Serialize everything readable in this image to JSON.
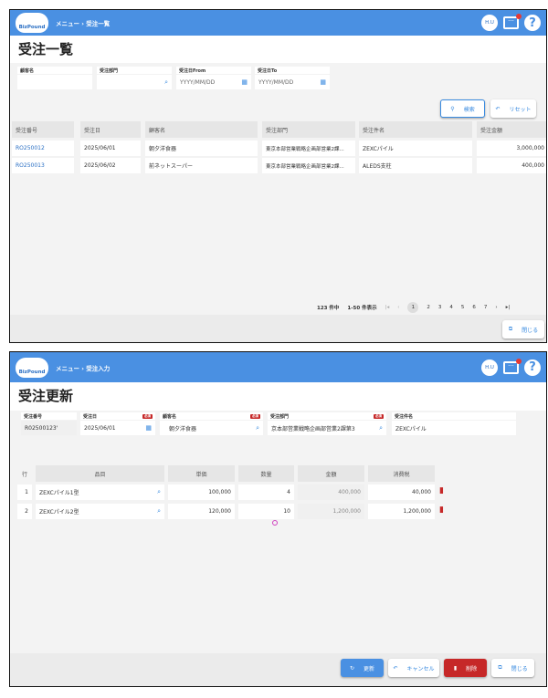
{
  "list_screen": {
    "header": {
      "logo": "BizPound",
      "breadcrumb": "メニュー › 受注一覧",
      "user": "H.U",
      "help": "?"
    },
    "title": "受注一覧",
    "filters": [
      {
        "label": "顧客名",
        "value": ""
      },
      {
        "label": "受注部門",
        "value": ""
      },
      {
        "label": "受注日From",
        "placeholder": "YYYY/MM/DD"
      },
      {
        "label": "受注日To",
        "placeholder": "YYYY/MM/DD"
      }
    ],
    "search_label": "検索",
    "reset_label": "リセット",
    "columns": [
      "受注番号",
      "受注日",
      "顧客名",
      "受注部門",
      "受注件名",
      "受注金額"
    ],
    "rows": [
      {
        "no": "RO250012",
        "date": "2025/06/01",
        "customer": "朝夕洋食器",
        "dept": "東京本部営業戦略企画部営業2課...",
        "subject": "ZEXCパイル",
        "amount": "3,000,000"
      },
      {
        "no": "RO250013",
        "date": "2025/06/02",
        "customer": "前ネットスーパー",
        "dept": "東京本部営業戦略企画部営業2課...",
        "subject": "ALEDS支柱",
        "amount": "400,000"
      }
    ],
    "pagination": {
      "total": "123 件中",
      "range": "1-50 件表示",
      "pages": [
        "1",
        "2",
        "3",
        "4",
        "5",
        "6",
        "7"
      ],
      "current": "1"
    },
    "close_label": "閉じる"
  },
  "edit_screen": {
    "header": {
      "logo": "BizPound",
      "breadcrumb": "メニュー › 受注入力",
      "user": "H.U",
      "help": "?"
    },
    "title": "受注更新",
    "required_badge": "必須",
    "fields": {
      "order_no": {
        "label": "受注番号",
        "value": "R02500123'"
      },
      "order_date": {
        "label": "受注日",
        "value": "2025/06/01"
      },
      "customer": {
        "label": "顧客名",
        "value": "朝夕洋食器"
      },
      "dept": {
        "label": "受注部門",
        "value": "京本部営業戦略企画部営業2課第3"
      },
      "subject": {
        "label": "受注件名",
        "value": "ZEXCパイル"
      }
    },
    "columns": [
      "行",
      "品目",
      "単価",
      "数量",
      "金額",
      "消費税"
    ],
    "lines": [
      {
        "row": "1",
        "item": "ZEXCパイル1型",
        "price": "100,000",
        "qty": "4",
        "amount": "400,000",
        "tax": "40,000"
      },
      {
        "row": "2",
        "item": "ZEXCパイル2型",
        "price": "120,000",
        "qty": "10",
        "amount": "1,200,000",
        "tax": "1,200,000"
      }
    ],
    "buttons": {
      "update": "更新",
      "cancel": "キャンセル",
      "delete": "削除",
      "close": "閉じる"
    }
  },
  "colors": {
    "header": "#4a90e2",
    "delete": "#c62828",
    "link": "#2a6fc4"
  }
}
